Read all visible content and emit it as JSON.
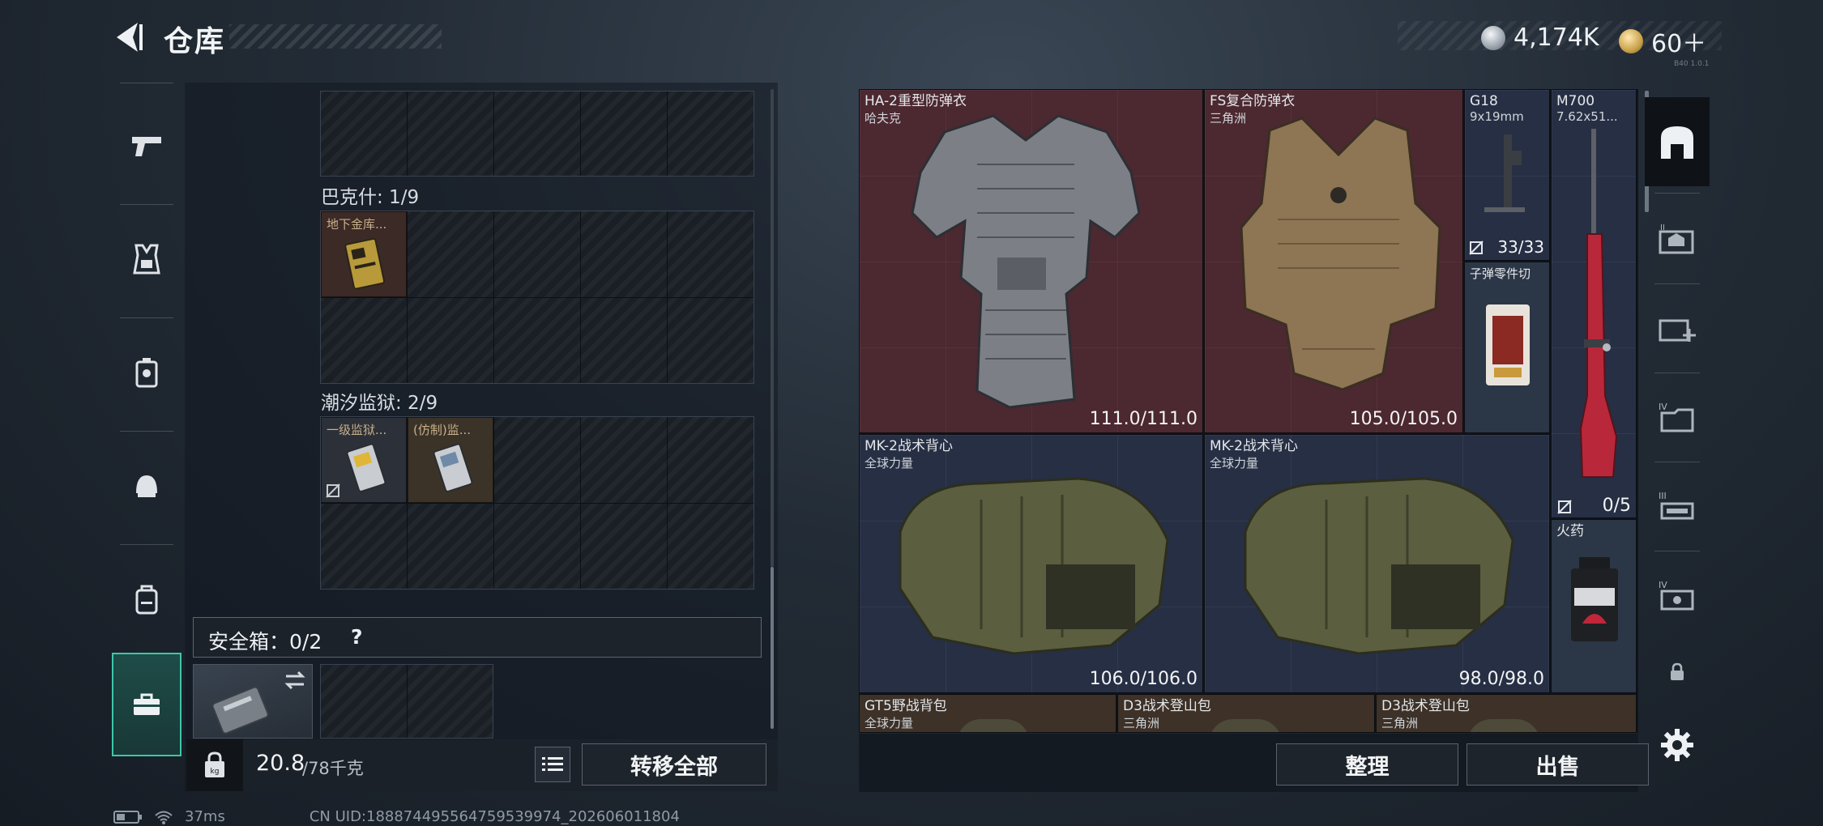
{
  "header": {
    "title": "仓库",
    "currency_primary": "4,174K",
    "currency_secondary": "60＋",
    "version": "B40 1.0.1"
  },
  "left_sidebar": {
    "items": [
      {
        "name": "weapons",
        "icon": "pistol-icon"
      },
      {
        "name": "armor",
        "icon": "vest-icon"
      },
      {
        "name": "chest-rig",
        "icon": "rig-icon"
      },
      {
        "name": "helmet",
        "icon": "helmet-icon"
      },
      {
        "name": "backpack",
        "icon": "backpack-icon"
      },
      {
        "name": "safebox",
        "icon": "briefcase-icon",
        "active": true
      }
    ]
  },
  "containers": {
    "bakshi": {
      "label": "巴克什: 1/9",
      "items": [
        {
          "name": "地下金库..."
        }
      ]
    },
    "tidal_prison": {
      "label": "潮汐监狱: 2/9",
      "items": [
        {
          "name": "一级监狱..."
        },
        {
          "name": "(仿制)监..."
        }
      ]
    },
    "safebox": {
      "label": "安全箱：0/2",
      "help": "?"
    }
  },
  "bottom_left": {
    "weight": "20.8",
    "weight_max": "/78千克",
    "transfer_all": "转移全部"
  },
  "stash": {
    "items": [
      {
        "name": "HA-2重型防弹衣",
        "sub": "哈夫克",
        "value": "111.0/111.0"
      },
      {
        "name": "FS复合防弹衣",
        "sub": "三角洲",
        "value": "105.0/105.0"
      },
      {
        "name": "G18",
        "sub": "9x19mm",
        "value": "33/33"
      },
      {
        "name": "M700",
        "sub": "7.62x51...",
        "value": "0/5"
      },
      {
        "name": "子弹零件切",
        "sub": "",
        "value": ""
      },
      {
        "name": "MK-2战术背心",
        "sub": "全球力量",
        "value": "106.0/106.0"
      },
      {
        "name": "MK-2战术背心",
        "sub": "全球力量",
        "value": "98.0/98.0"
      },
      {
        "name": "火药",
        "sub": "",
        "value": ""
      },
      {
        "name": "GT5野战背包",
        "sub": "全球力量",
        "value": ""
      },
      {
        "name": "D3战术登山包",
        "sub": "三角洲",
        "value": ""
      },
      {
        "name": "D3战术登山包",
        "sub": "三角洲",
        "value": ""
      }
    ],
    "sort_label": "整理",
    "sell_label": "出售"
  },
  "right_rail": {
    "items": [
      "stash-home-icon",
      "tab-2-icon",
      "tab-add-icon",
      "tab-4-icon",
      "tab-3-icon",
      "tab-iv-icon"
    ]
  },
  "status_bar": {
    "ping": "37ms",
    "uid": "CN UID:188874495564759539974_202606011804"
  },
  "colors": {
    "accent": "#3fc6a8",
    "red_slot": "#4c2830",
    "blue_slot": "#262f44"
  }
}
